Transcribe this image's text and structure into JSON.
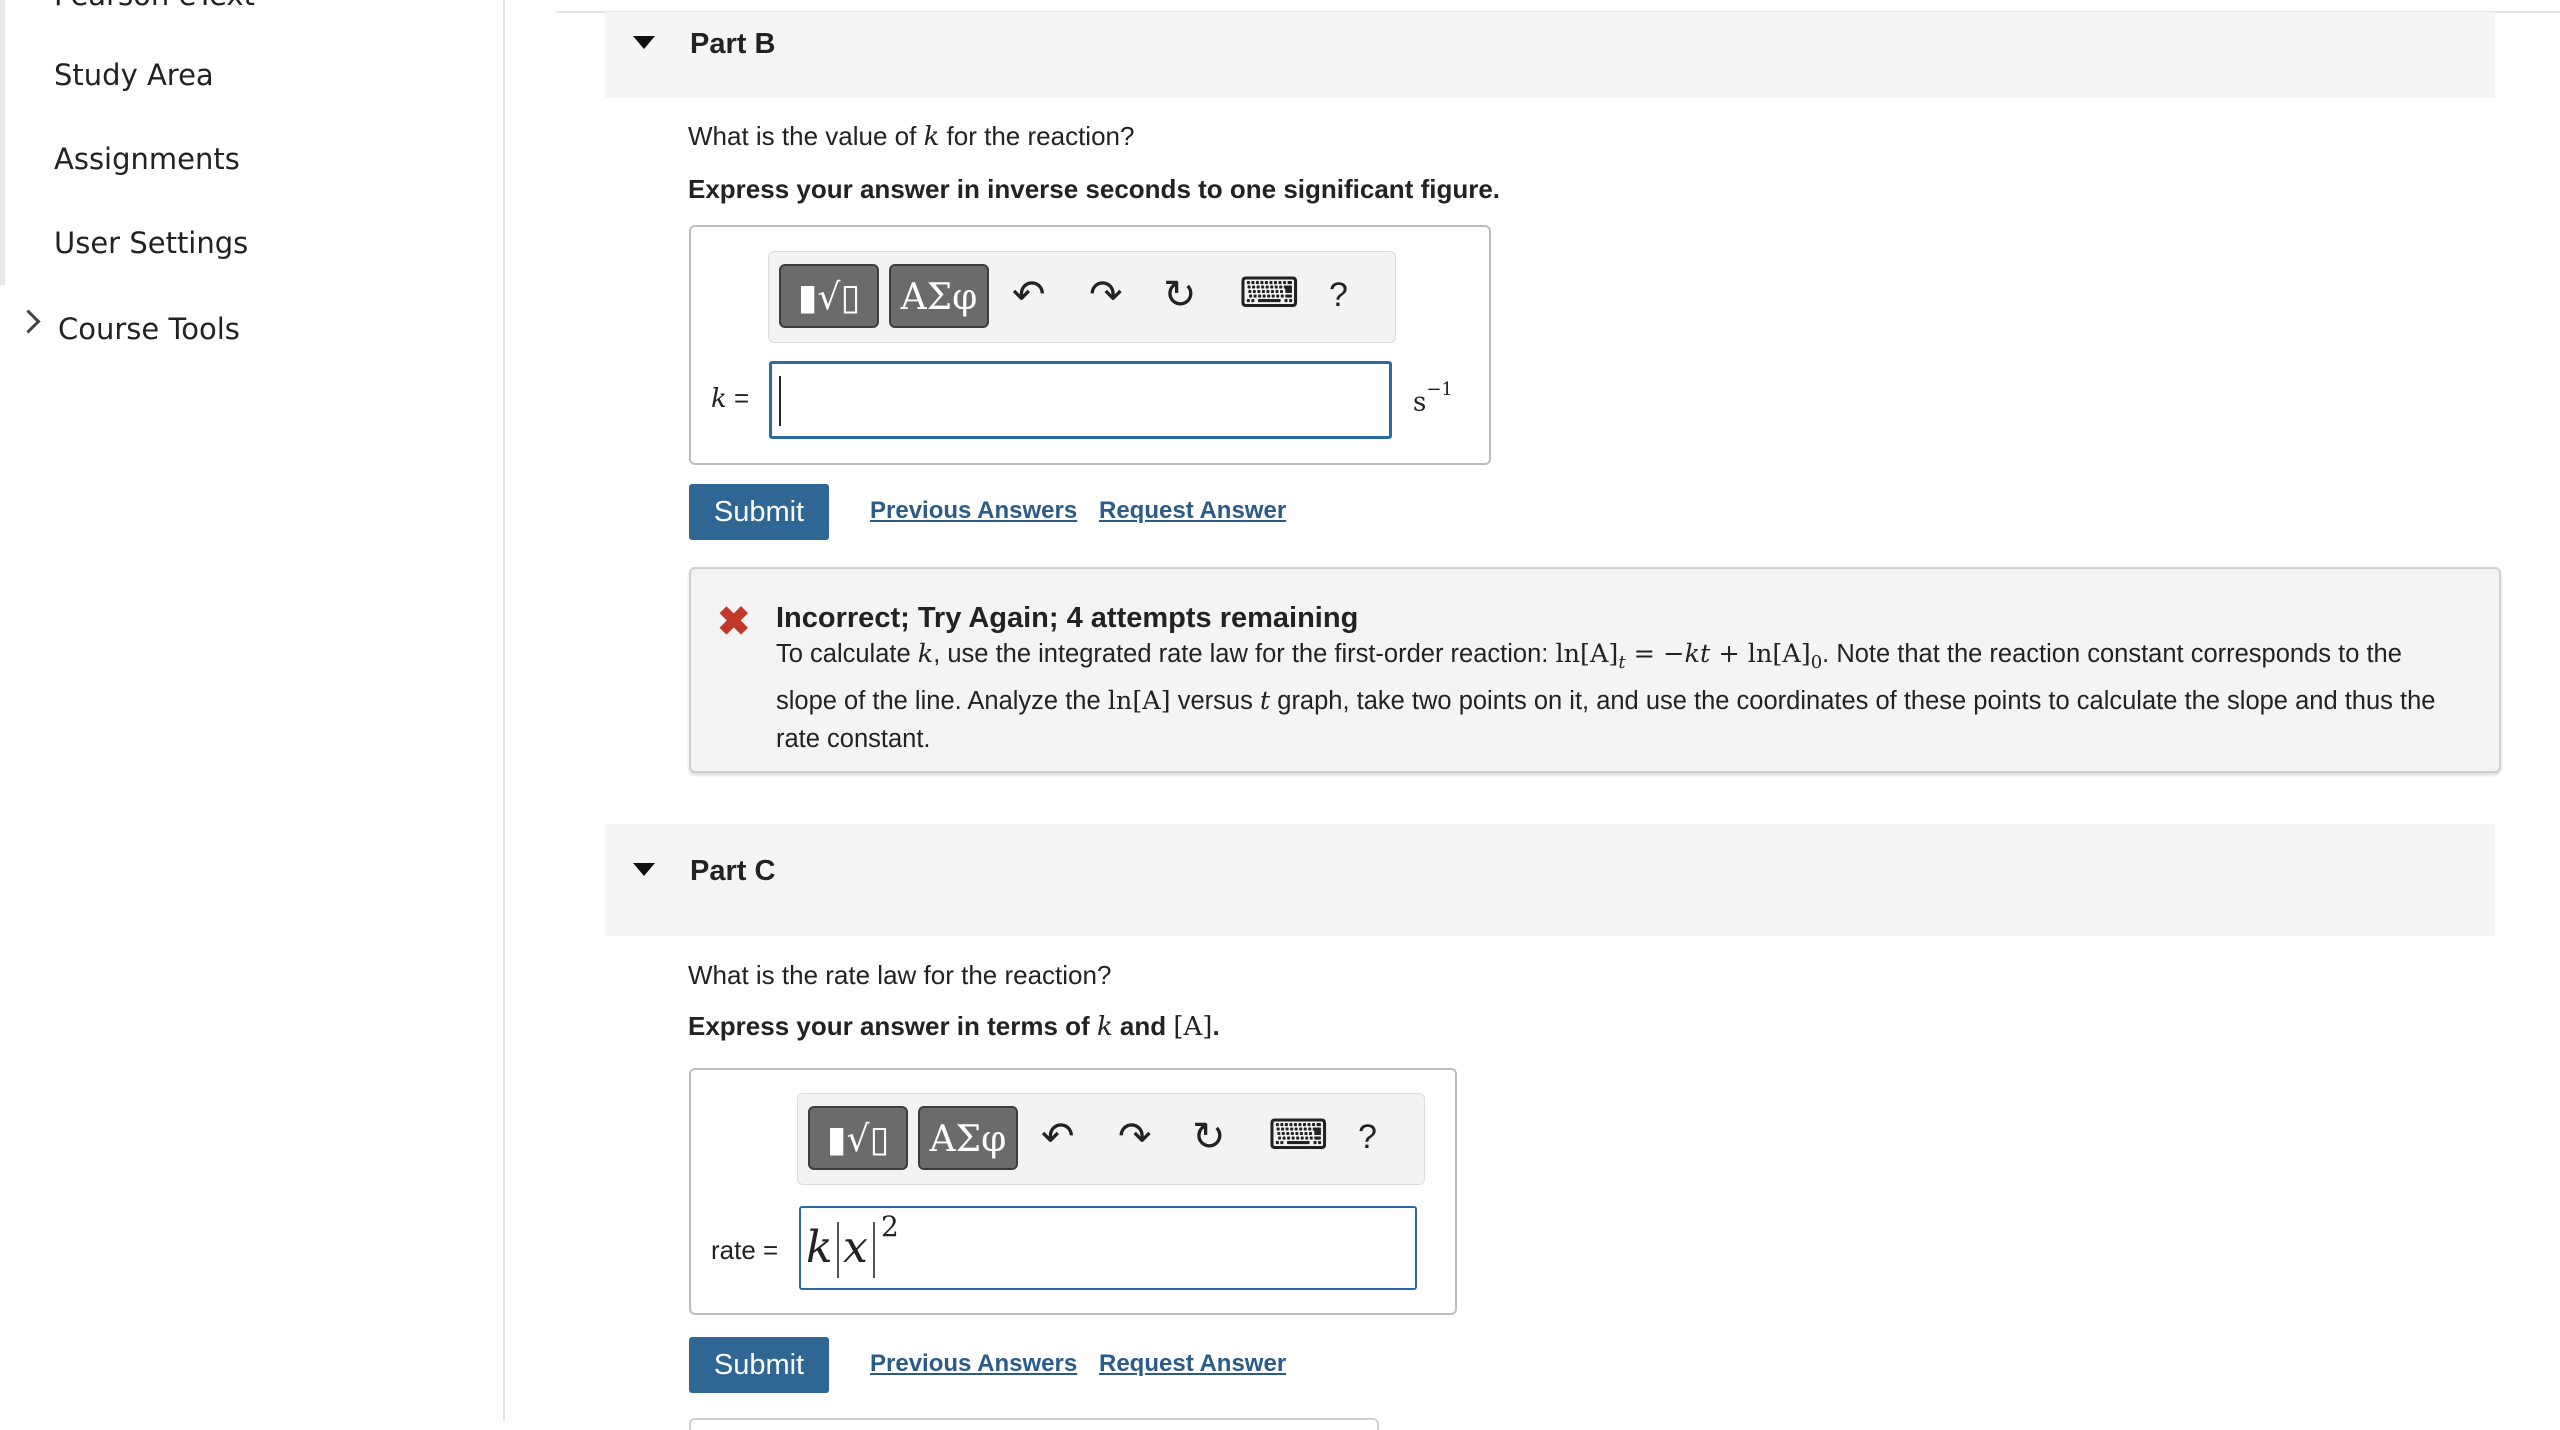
{
  "sidebar": {
    "cut_item": "Pearson eText",
    "items": [
      {
        "label": "Study Area"
      },
      {
        "label": "Assignments"
      },
      {
        "label": "User Settings"
      },
      {
        "label": "Course Tools"
      }
    ]
  },
  "partB": {
    "title": "Part B",
    "question_pre": "What is the value of ",
    "question_var": "k",
    "question_post": " for the reaction?",
    "instruction": "Express your answer in inverse seconds to one significant figure.",
    "toolbar": {
      "templates_glyph": "▮√▯",
      "greek_glyph": "ΑΣφ",
      "undo": "↶",
      "redo": "↷",
      "reset": "↻",
      "keyboard": "⌨",
      "help": "?"
    },
    "input_label_var": "k",
    "input_label_eq": " =",
    "input_value": "",
    "unit_base": "s",
    "unit_exp": "−1",
    "submit": "Submit",
    "previous_answers": "Previous Answers",
    "request_answer": "Request Answer",
    "feedback": {
      "title": "Incorrect; Try Again; 4 attempts remaining",
      "t1": "To calculate ",
      "t2": "k",
      "t3": ", use the integrated rate law for the first-order reaction: ",
      "m1": "ln[A]",
      "m1sub": "t",
      "m2": " = −",
      "m3": "kt",
      "m4": " + ln[A]",
      "m4sub": "0",
      "t4": ". Note that the reaction constant corresponds to the slope of the line. Analyze the ",
      "m5": "ln[A]",
      "t5": " versus ",
      "t6": "t",
      "t7": " graph, take two points on it, and use the coordinates of these points to calculate the slope and thus the rate constant."
    }
  },
  "partC": {
    "title": "Part C",
    "question": "What is the rate law for the reaction?",
    "instruction_pre": "Express your answer in terms of ",
    "instruction_var": "k",
    "instruction_mid": " and ",
    "instruction_bracket": "[A]",
    "instruction_post": ".",
    "toolbar": {
      "templates_glyph": "▮√▯",
      "greek_glyph": "ΑΣφ",
      "undo": "↶",
      "redo": "↷",
      "reset": "↻",
      "keyboard": "⌨",
      "help": "?"
    },
    "input_label": "rate =",
    "input_k": "k",
    "input_x": "x",
    "input_exp": "2",
    "submit": "Submit",
    "previous_answers": "Previous Answers",
    "request_answer": "Request Answer"
  }
}
